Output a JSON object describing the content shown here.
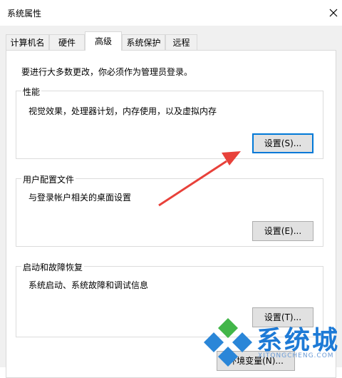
{
  "window": {
    "title": "系统属性"
  },
  "tabs": [
    {
      "label": "计算机名"
    },
    {
      "label": "硬件"
    },
    {
      "label": "高级"
    },
    {
      "label": "系统保护"
    },
    {
      "label": "远程"
    }
  ],
  "notice": "要进行大多数更改，你必须作为管理员登录。",
  "performance": {
    "title": "性能",
    "description": "视觉效果，处理器计划，内存使用，以及虚拟内存",
    "button": "设置(S)..."
  },
  "user_profiles": {
    "title": "用户配置文件",
    "description": "与登录帐户相关的桌面设置",
    "button": "设置(E)..."
  },
  "startup_recovery": {
    "title": "启动和故障恢复",
    "description": "系统启动、系统故障和调试信息",
    "button": "设置(T)..."
  },
  "env_button": "环境变量(N)...",
  "watermark": {
    "text": "系统城",
    "sub": "XITONGCHENG.COM"
  },
  "colors": {
    "focus_border": "#0078d7",
    "arrow": "#e8413a"
  }
}
